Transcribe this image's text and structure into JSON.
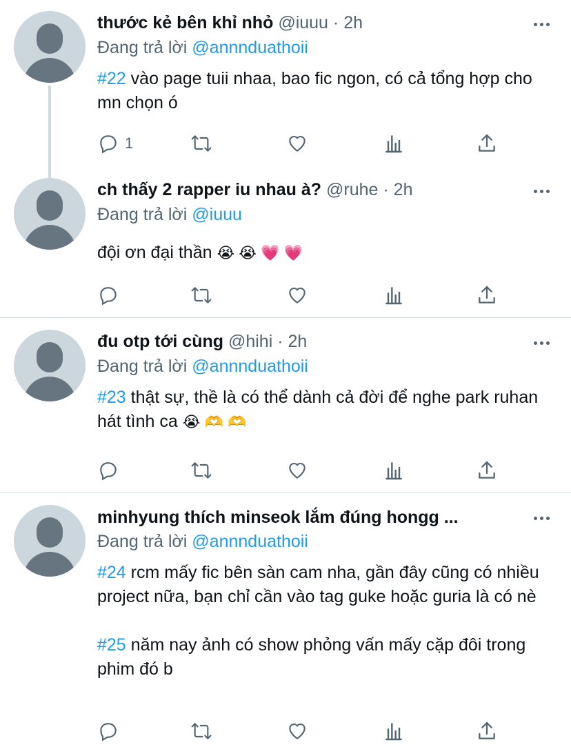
{
  "tweets": [
    {
      "name": "thước kẻ bên khỉ nhỏ",
      "handle": "@iuuu",
      "time": "· 2h",
      "reply_label": "Đang trả lời",
      "reply_to": "@annnduathoii",
      "tag": "#22",
      "text": " vào page tuii nhaa, bao fic ngon, có cả tổng hợp cho mn chọn ó",
      "reply_count": "1"
    },
    {
      "name": "ch thấy 2 rapper iu nhau à?",
      "handle": "@ruhe",
      "time": "· 2h",
      "reply_label": "Đang trả lời",
      "reply_to": "@iuuu",
      "text": "đội ơn đại thần",
      "emojis": "😭 😭 💗 💗",
      "reply_count": ""
    },
    {
      "name": "đu otp tới cùng",
      "handle": "@hihi",
      "time": "· 2h",
      "reply_label": "Đang trả lời",
      "reply_to": "@annnduathoii",
      "tag": "#23",
      "text": " thật sự, thề là có thể dành cả đời để nghe park ruhan hát tình ca",
      "emojis": "😭 🫶 🫶",
      "reply_count": ""
    },
    {
      "name": "minhyung thích minseok lắm đúng hongg ...",
      "reply_label": "Đang trả lời",
      "reply_to": "@annnduathoii",
      "tag": "#24",
      "text": " rcm mấy fic bên sàn cam nha, gần đây cũng có nhiều project nữa, bạn chỉ cần vào tag guke hoặc guria là có nè",
      "tag2": "#25",
      "text2": " năm nay ảnh có show phỏng vấn mấy cặp đôi trong phim đó b",
      "reply_count": ""
    }
  ],
  "icons": [
    "reply-icon",
    "retweet-icon",
    "like-icon",
    "analytics-icon",
    "share-icon",
    "more-icon"
  ],
  "colors": {
    "link": "#1d9bf0",
    "muted": "#536471",
    "text": "#0f1419",
    "avatar_bg": "#ccd6dd"
  }
}
